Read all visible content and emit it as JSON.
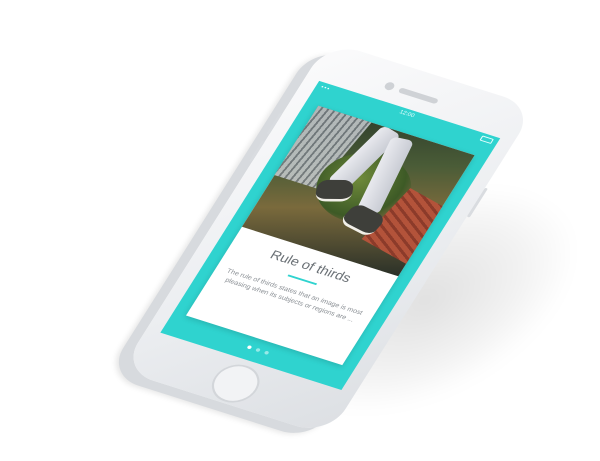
{
  "status_bar": {
    "time": "12:00"
  },
  "card": {
    "title": "Rule of thirds",
    "body": "The rule of thirds states that an image is most pleasing when its subjects or regions are ..."
  },
  "pager": {
    "count": 3,
    "active_index": 0
  },
  "colors": {
    "accent": "#2fd3cf",
    "phone_body": "#eceef1",
    "card_background": "#ffffff"
  }
}
